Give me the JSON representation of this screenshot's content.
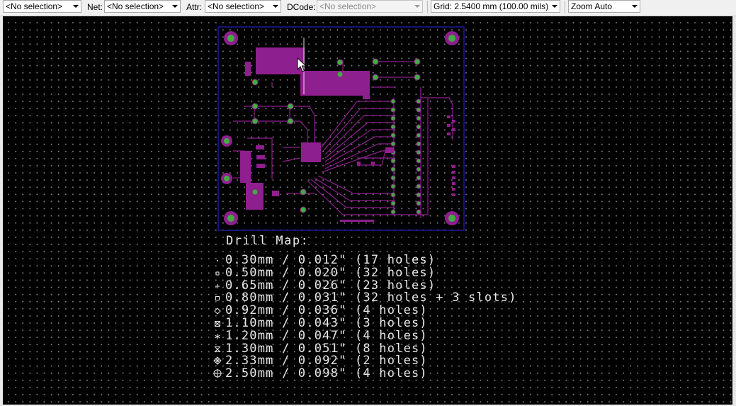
{
  "toolbar": {
    "combo1": "<No selection>",
    "net_label": "Net:",
    "net_value": "<No selection>",
    "attr_label": "Attr:",
    "attr_value": "<No selection>",
    "dcode_label": "DCode:",
    "dcode_value": "<No selection>",
    "grid_value": "Grid: 2.5400 mm (100.00 mils)",
    "zoom_value": "Zoom Auto"
  },
  "drill_map": {
    "title": "Drill Map:",
    "entries": [
      {
        "text": "0.30mm / 0.012\" (17 holes)",
        "symbol": "dot-icon"
      },
      {
        "text": "0.50mm / 0.020\" (32 holes)",
        "symbol": "small-square-icon"
      },
      {
        "text": "0.65mm / 0.026\" (23 holes)",
        "symbol": "plus-icon"
      },
      {
        "text": "0.80mm / 0.031\" (32 holes + 3 slots)",
        "symbol": "square-icon"
      },
      {
        "text": "0.92mm / 0.036\" (4 holes)",
        "symbol": "diamond-icon"
      },
      {
        "text": "1.10mm / 0.043\" (3 holes)",
        "symbol": "square-x-icon"
      },
      {
        "text": "1.20mm / 0.047\" (4 holes)",
        "symbol": "asterisk-icon"
      },
      {
        "text": "1.30mm / 0.051\" (8 holes)",
        "symbol": "hourglass-icon"
      },
      {
        "text": "2.33mm / 0.092\" (2 holes)",
        "symbol": "diamond-x-icon"
      },
      {
        "text": "2.50mm / 0.098\" (4 holes)",
        "symbol": "circle-plus-icon"
      }
    ]
  },
  "colors": {
    "canvas_bg": "#000000",
    "grid_dot": "#7a7a7a",
    "copper": "#8e1f8e",
    "outline": "#1a1a9c",
    "drill_text": "#e8e8e8",
    "pad_green": "#3fae3f"
  }
}
